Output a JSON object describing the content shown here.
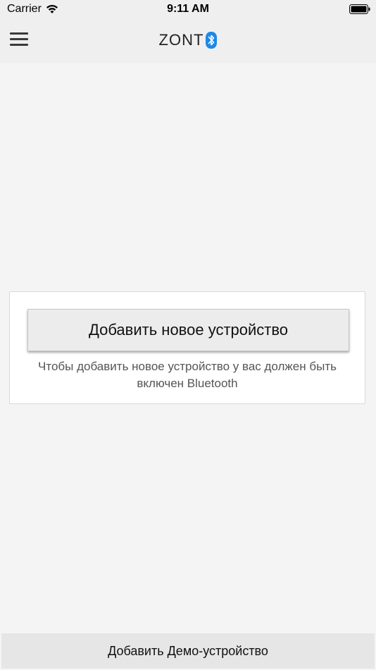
{
  "status_bar": {
    "carrier": "Carrier",
    "time": "9:11 AM",
    "wifi_icon": "wifi-icon",
    "battery_icon": "battery-icon"
  },
  "nav": {
    "menu_icon": "hamburger-menu-icon",
    "logo_text": "ZONT",
    "logo_icon": "bluetooth-icon",
    "accent_color": "#1e88e5"
  },
  "card": {
    "add_device_label": "Добавить новое устройство",
    "hint_line1": "Чтобы добавить новое устройство у вас должен быть",
    "hint_line2": "включен Bluetooth"
  },
  "footer": {
    "demo_label": "Добавить Демо-устройство"
  }
}
